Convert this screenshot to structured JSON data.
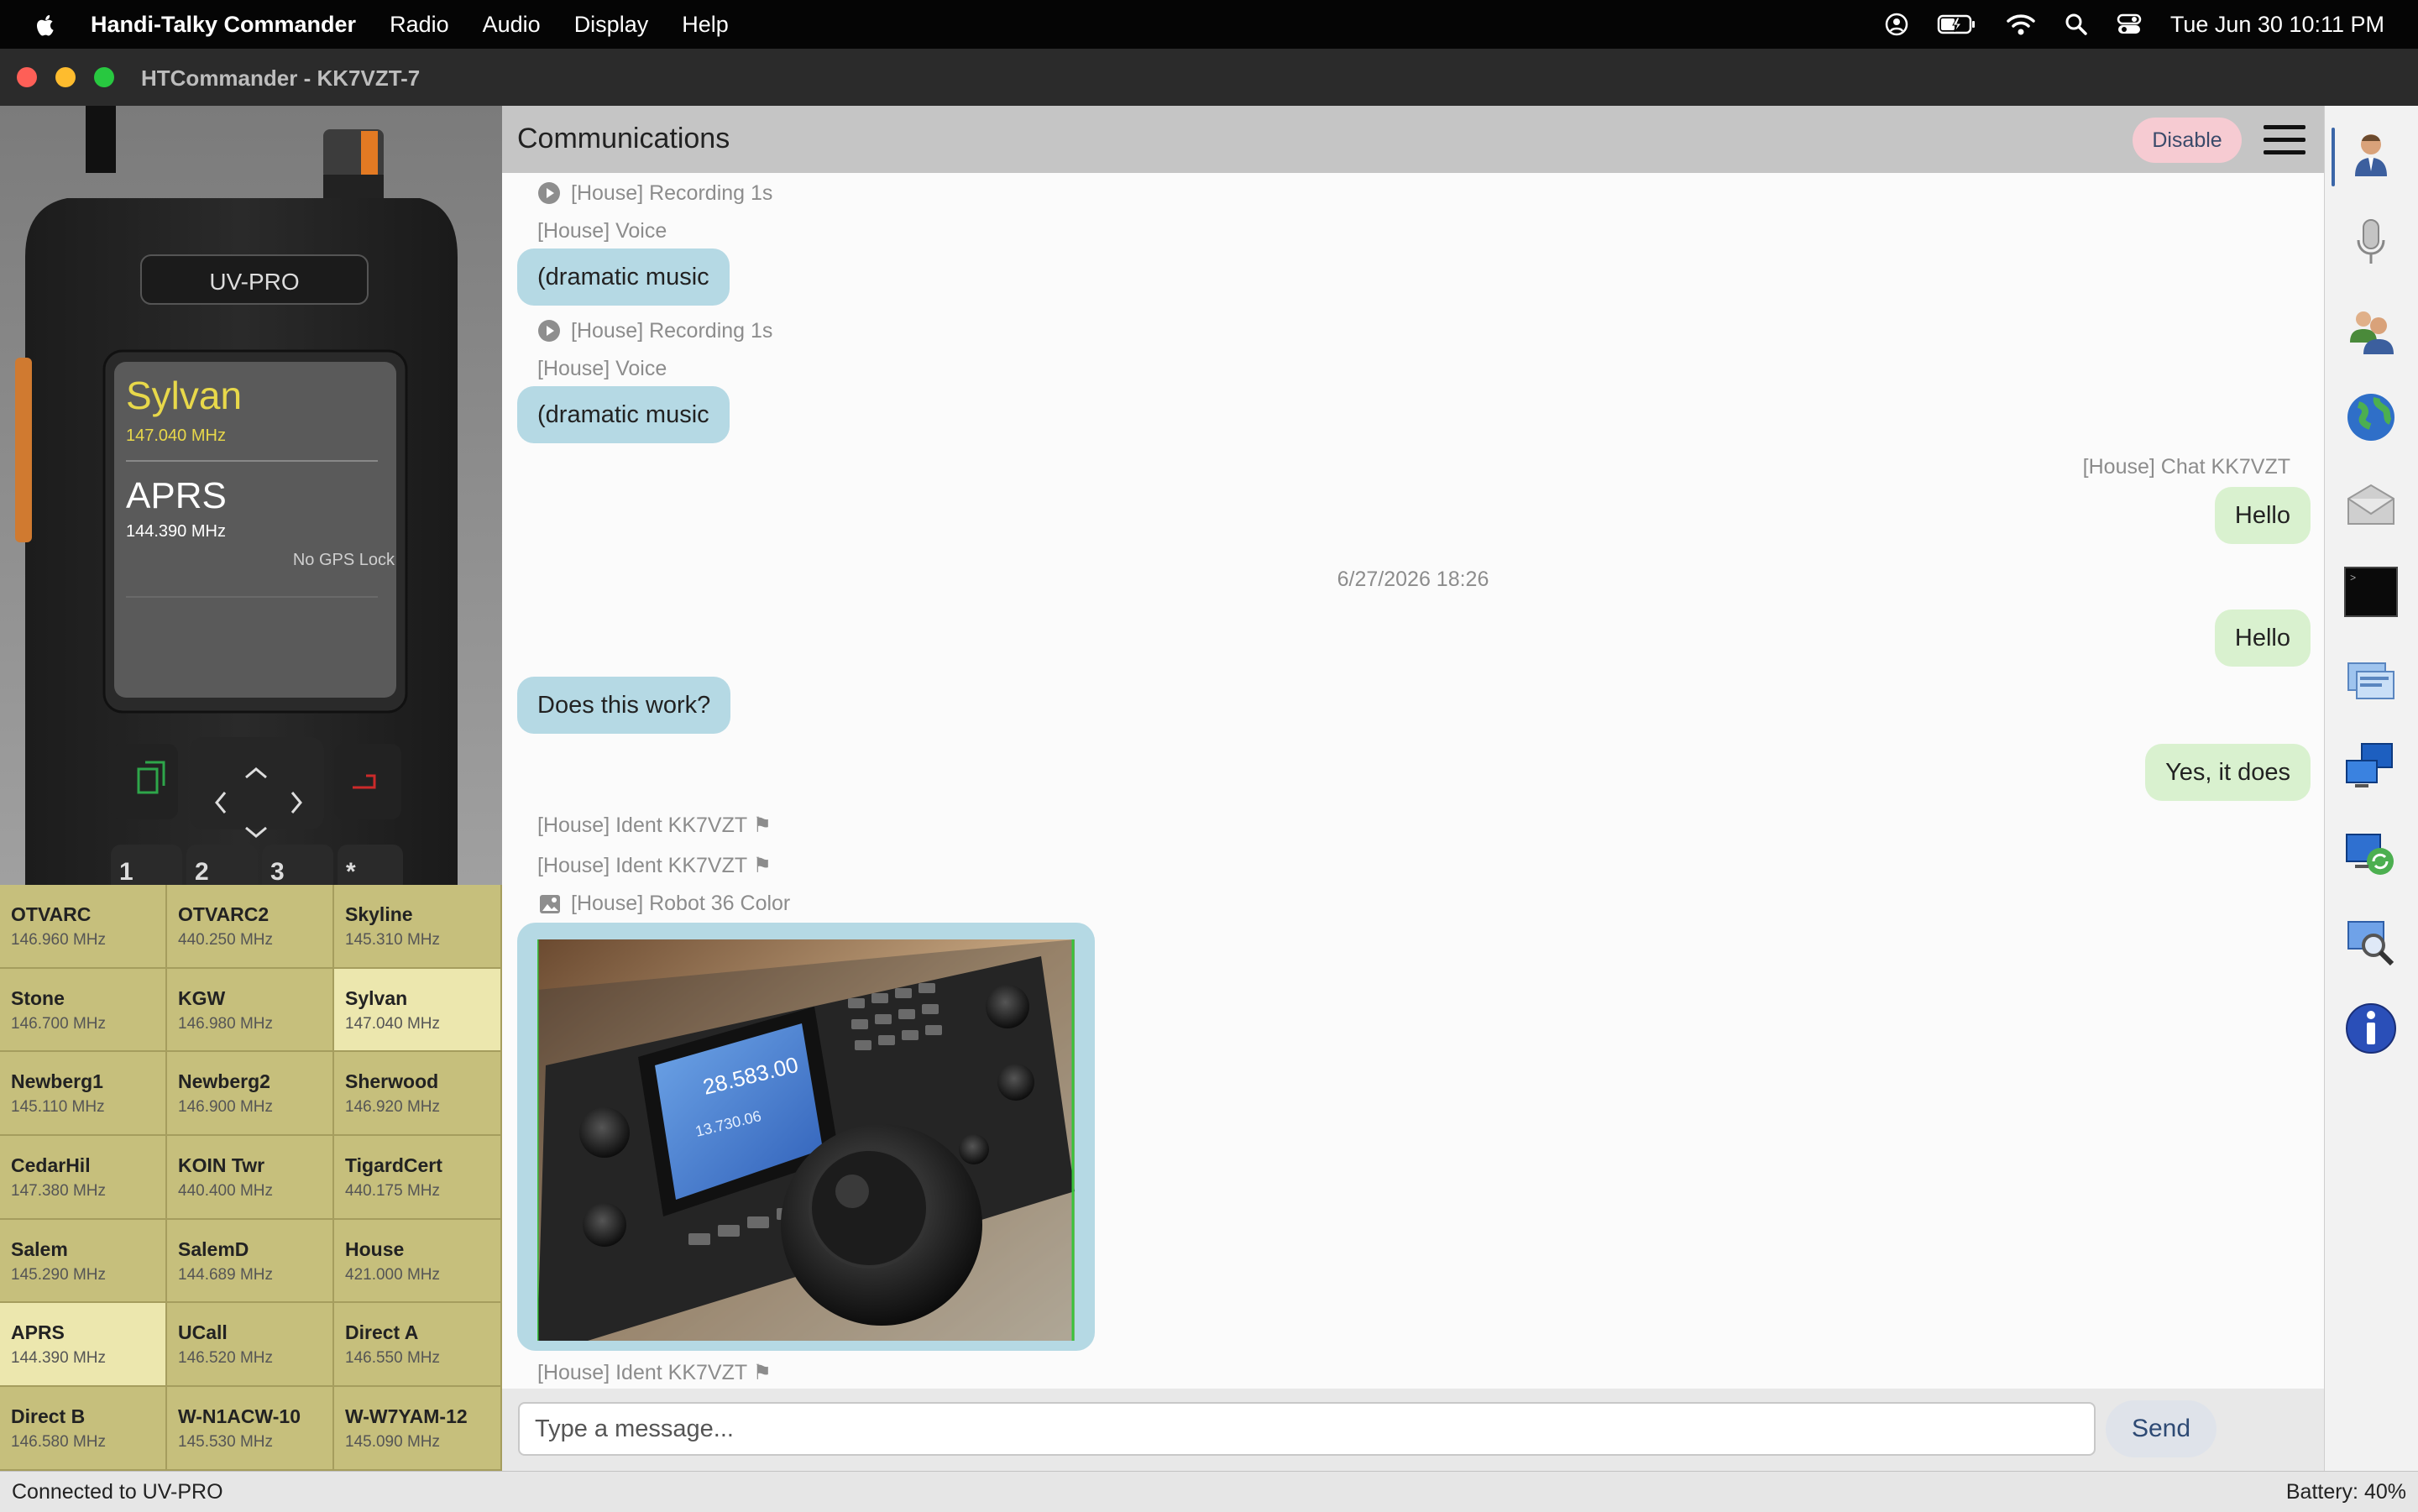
{
  "menubar": {
    "app_name": "Handi-Talky Commander",
    "menus": [
      "Radio",
      "Audio",
      "Display",
      "Help"
    ],
    "datetime": "Tue Jun 30  10:11 PM"
  },
  "window": {
    "title": "HTCommander - KK7VZT-7"
  },
  "radio": {
    "model": "UV-PRO",
    "vfo_a_name": "Sylvan",
    "vfo_a_freq": "147.040 MHz",
    "vfo_b_name": "APRS",
    "vfo_b_freq": "144.390 MHz",
    "gps_status": "No GPS Lock"
  },
  "channels": [
    {
      "name": "OTVARC",
      "freq": "146.960 MHz",
      "active": false
    },
    {
      "name": "OTVARC2",
      "freq": "440.250 MHz",
      "active": false
    },
    {
      "name": "Skyline",
      "freq": "145.310 MHz",
      "active": false
    },
    {
      "name": "Stone",
      "freq": "146.700 MHz",
      "active": false
    },
    {
      "name": "KGW",
      "freq": "146.980 MHz",
      "active": false
    },
    {
      "name": "Sylvan",
      "freq": "147.040 MHz",
      "active": true
    },
    {
      "name": "Newberg1",
      "freq": "145.110 MHz",
      "active": false
    },
    {
      "name": "Newberg2",
      "freq": "146.900 MHz",
      "active": false
    },
    {
      "name": "Sherwood",
      "freq": "146.920 MHz",
      "active": false
    },
    {
      "name": "CedarHil",
      "freq": "147.380 MHz",
      "active": false
    },
    {
      "name": "KOIN Twr",
      "freq": "440.400 MHz",
      "active": false
    },
    {
      "name": "TigardCert",
      "freq": "440.175 MHz",
      "active": false
    },
    {
      "name": "Salem",
      "freq": "145.290 MHz",
      "active": false
    },
    {
      "name": "SalemD",
      "freq": "144.689 MHz",
      "active": false
    },
    {
      "name": "House",
      "freq": "421.000 MHz",
      "active": false
    },
    {
      "name": "APRS",
      "freq": "144.390 MHz",
      "active": true
    },
    {
      "name": "UCall",
      "freq": "146.520 MHz",
      "active": false
    },
    {
      "name": "Direct A",
      "freq": "146.550 MHz",
      "active": false
    },
    {
      "name": "Direct B",
      "freq": "146.580 MHz",
      "active": false
    },
    {
      "name": "W-N1ACW-10",
      "freq": "145.530 MHz",
      "active": false
    },
    {
      "name": "W-W7YAM-12",
      "freq": "145.090 MHz",
      "active": false
    }
  ],
  "comm": {
    "title": "Communications",
    "disable_label": "Disable",
    "messages": {
      "rec1": "[House] Recording 1s",
      "voice1": "[House] Voice",
      "bubble1": "(dramatic music",
      "rec2": "[House] Recording 1s",
      "voice2": "[House] Voice",
      "bubble2": "(dramatic music",
      "chat_sender": "[House] Chat KK7VZT",
      "hello1": "Hello",
      "timestamp": "6/27/2026 18:26",
      "hello2": "Hello",
      "q": "Does this work?",
      "a": "Yes, it does",
      "ident1": "[House] Ident KK7VZT ⚑",
      "ident2": "[House] Ident KK7VZT ⚑",
      "sstv": "[House] Robot 36 Color",
      "ident3": "[House] Ident KK7VZT ⚑"
    },
    "sstv_image": {
      "freq_readout": "28.583.00",
      "sub_readout": "13.730.06"
    },
    "input_placeholder": "Type a message...",
    "send_label": "Send"
  },
  "toolbar_icons": [
    "contacts-icon",
    "microphone-icon",
    "users-icon",
    "globe-icon",
    "mail-icon",
    "terminal-icon",
    "bbs-icon",
    "network-icon",
    "torrent-icon",
    "search-icon",
    "info-icon"
  ],
  "status": {
    "left": "Connected to UV-PRO",
    "right": "Battery: 40%"
  },
  "colors": {
    "channel_bg": "#c6bf7c",
    "channel_active": "#ece7ae",
    "bubble_in": "#b5d9e4",
    "bubble_out": "#d9f1cf",
    "disable_btn": "#f6cbd2"
  }
}
